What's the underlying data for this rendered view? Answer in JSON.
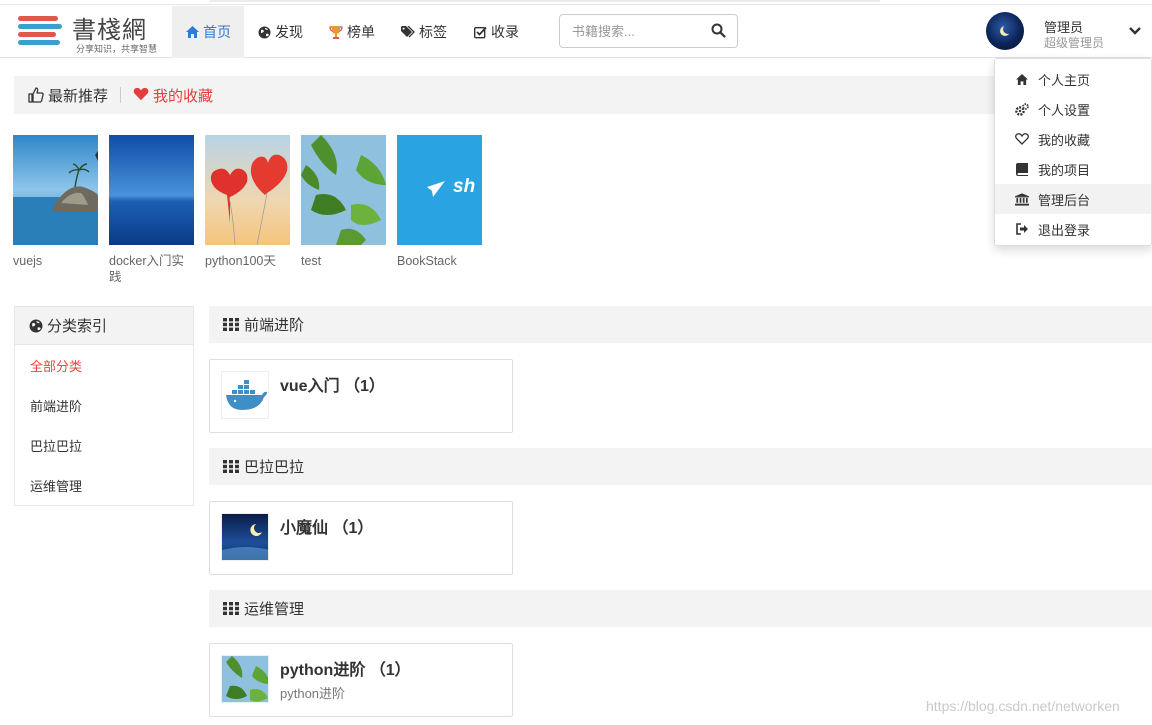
{
  "logo": {
    "name": "書棧網",
    "slogan": "分享知识，共享智慧"
  },
  "nav": [
    {
      "label": "首页",
      "icon": "home-icon",
      "active": true
    },
    {
      "label": "发现",
      "icon": "globe-icon"
    },
    {
      "label": "榜单",
      "icon": "trophy-icon"
    },
    {
      "label": "标签",
      "icon": "tags-icon"
    },
    {
      "label": "收录",
      "icon": "check-square-icon"
    }
  ],
  "search": {
    "placeholder": "书籍搜索...",
    "value": ""
  },
  "user": {
    "name": "管理员",
    "role": "超级管理员"
  },
  "dropdown": [
    {
      "label": "个人主页",
      "icon": "home-icon"
    },
    {
      "label": "个人设置",
      "icon": "cogs-icon"
    },
    {
      "label": "我的收藏",
      "icon": "heart-outline-icon"
    },
    {
      "label": "我的项目",
      "icon": "book-icon"
    },
    {
      "label": "管理后台",
      "icon": "bank-icon",
      "hover": true
    },
    {
      "label": "退出登录",
      "icon": "sign-out-icon"
    }
  ],
  "recommend": {
    "latest": "最新推荐",
    "favorites": "我的收藏"
  },
  "books": [
    {
      "name": "vuejs",
      "cover": "beach-rocks"
    },
    {
      "name": "docker入门实践",
      "cover": "blue-sea"
    },
    {
      "name": "python100天",
      "cover": "red-balloons"
    },
    {
      "name": "test",
      "cover": "green-leaves"
    },
    {
      "name": "BookStack",
      "cover": "bookstack-logo",
      "cover_text": "sh"
    }
  ],
  "categories": {
    "title": "分类索引",
    "items": [
      "全部分类",
      "前端进阶",
      "巴拉巴拉",
      "运维管理"
    ]
  },
  "sections": [
    {
      "title": "前端进阶",
      "card": {
        "title": "vue入门 （1）",
        "desc": "",
        "thumb": "docker-whale"
      }
    },
    {
      "title": "巴拉巴拉",
      "card": {
        "title": "小魔仙 （1）",
        "desc": "",
        "thumb": "night-moon"
      }
    },
    {
      "title": "运维管理",
      "card": {
        "title": "python进阶 （1）",
        "desc": "python进阶",
        "thumb": "green-leaves"
      }
    }
  ],
  "watermark": "https://blog.csdn.net/networken",
  "colors": {
    "accent_blue": "#2f7ad3",
    "accent_red": "#e43d3d",
    "category_active": "#e04a3a"
  }
}
